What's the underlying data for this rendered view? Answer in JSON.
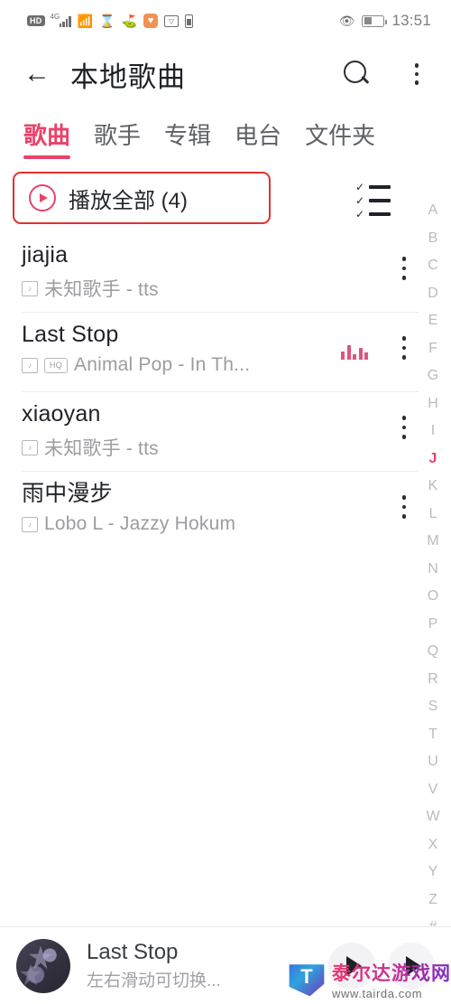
{
  "statusbar": {
    "hd_label": "HD",
    "network_label": "4G",
    "icons": [
      "hd-icon",
      "signal-icon",
      "wifi-icon",
      "hourglass-icon",
      "person-walking-icon",
      "orange-app-icon",
      "inbox-icon",
      "battery-small-icon"
    ],
    "eye_icon": "eye-icon",
    "battery_icon": "battery-icon",
    "time": "13:51"
  },
  "appbar": {
    "back_icon": "back-arrow-icon",
    "title": "本地歌曲",
    "search_icon": "search-icon",
    "more_icon": "more-vertical-icon"
  },
  "tabs": [
    {
      "label": "歌曲",
      "active": true
    },
    {
      "label": "歌手",
      "active": false
    },
    {
      "label": "专辑",
      "active": false
    },
    {
      "label": "电台",
      "active": false
    },
    {
      "label": "文件夹",
      "active": false
    }
  ],
  "playall": {
    "label": "播放全部 (4)",
    "play_icon": "play-circle-icon",
    "multiselect_icon": "checklist-icon",
    "highlight_color": "#e3302f"
  },
  "songs": [
    {
      "title": "jiajia",
      "artist": "未知歌手 - tts",
      "file_badge": "file-icon",
      "hq_badge": "",
      "playing": false
    },
    {
      "title": "Last Stop",
      "artist": "Animal Pop - In Th...",
      "file_badge": "file-icon",
      "hq_badge": "HQ",
      "playing": true
    },
    {
      "title": "xiaoyan",
      "artist": "未知歌手 - tts",
      "file_badge": "file-icon",
      "hq_badge": "",
      "playing": false
    },
    {
      "title": "雨中漫步",
      "artist": "Lobo L - Jazzy Hokum",
      "file_badge": "file-icon",
      "hq_badge": "",
      "playing": false
    }
  ],
  "alpha_index": {
    "letters": [
      "A",
      "B",
      "C",
      "D",
      "E",
      "F",
      "G",
      "H",
      "I",
      "J",
      "K",
      "L",
      "M",
      "N",
      "O",
      "P",
      "Q",
      "R",
      "S",
      "T",
      "U",
      "V",
      "W",
      "X",
      "Y",
      "Z",
      "#"
    ],
    "active": "J",
    "active_color": "#e8436b"
  },
  "player": {
    "album_art": "album-art",
    "title": "Last Stop",
    "hint": "左右滑动可切换...",
    "play_icon": "play-icon",
    "next_icon": "play-secondary-icon"
  },
  "watermark": {
    "logo": "tairda-logo-icon",
    "name": "泰尔达游戏网",
    "url": "www.tairda.com"
  }
}
